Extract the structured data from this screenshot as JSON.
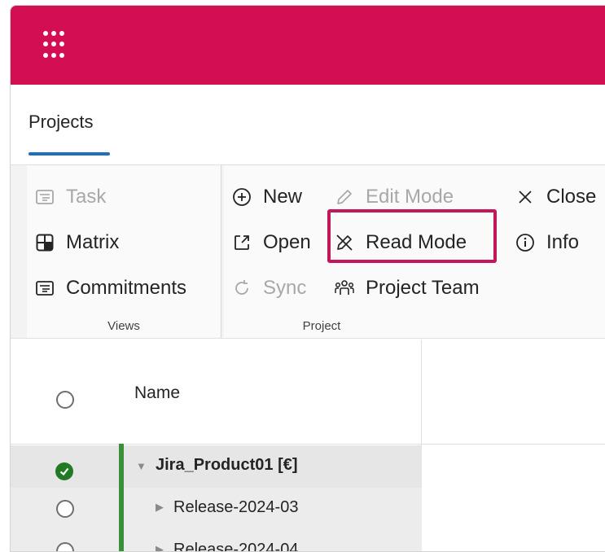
{
  "app": {
    "tab_label": "Projects",
    "accent_color": "#d40e52",
    "highlight_color": "#c2185b"
  },
  "ribbon": {
    "views": {
      "group_label": "Views",
      "items": [
        {
          "label": "Task",
          "icon": "task-icon",
          "enabled": false
        },
        {
          "label": "Matrix",
          "icon": "matrix-icon",
          "enabled": true
        },
        {
          "label": "Commitments",
          "icon": "commitments-icon",
          "enabled": true
        }
      ]
    },
    "project": {
      "group_label": "Project",
      "new": {
        "label": "New",
        "icon": "plus-circle-icon"
      },
      "edit_mode": {
        "label": "Edit Mode",
        "icon": "pencil-icon",
        "enabled": false
      },
      "close": {
        "label": "Close",
        "icon": "close-icon"
      },
      "open": {
        "label": "Open",
        "icon": "open-external-icon"
      },
      "read_mode": {
        "label": "Read Mode",
        "icon": "pencil-off-icon"
      },
      "info": {
        "label": "Info",
        "icon": "info-icon"
      },
      "sync": {
        "label": "Sync",
        "icon": "sync-icon",
        "enabled": false
      },
      "project_team": {
        "label": "Project Team",
        "icon": "people-team-icon"
      }
    }
  },
  "grid": {
    "column_name": "Name",
    "rows": [
      {
        "label": "Jira_Product01 [€]",
        "expanded": true,
        "selected": true
      },
      {
        "label": "Release-2024-03",
        "expanded": false,
        "selected": false
      },
      {
        "label": "Release-2024-04",
        "expanded": false,
        "selected": false
      }
    ]
  }
}
